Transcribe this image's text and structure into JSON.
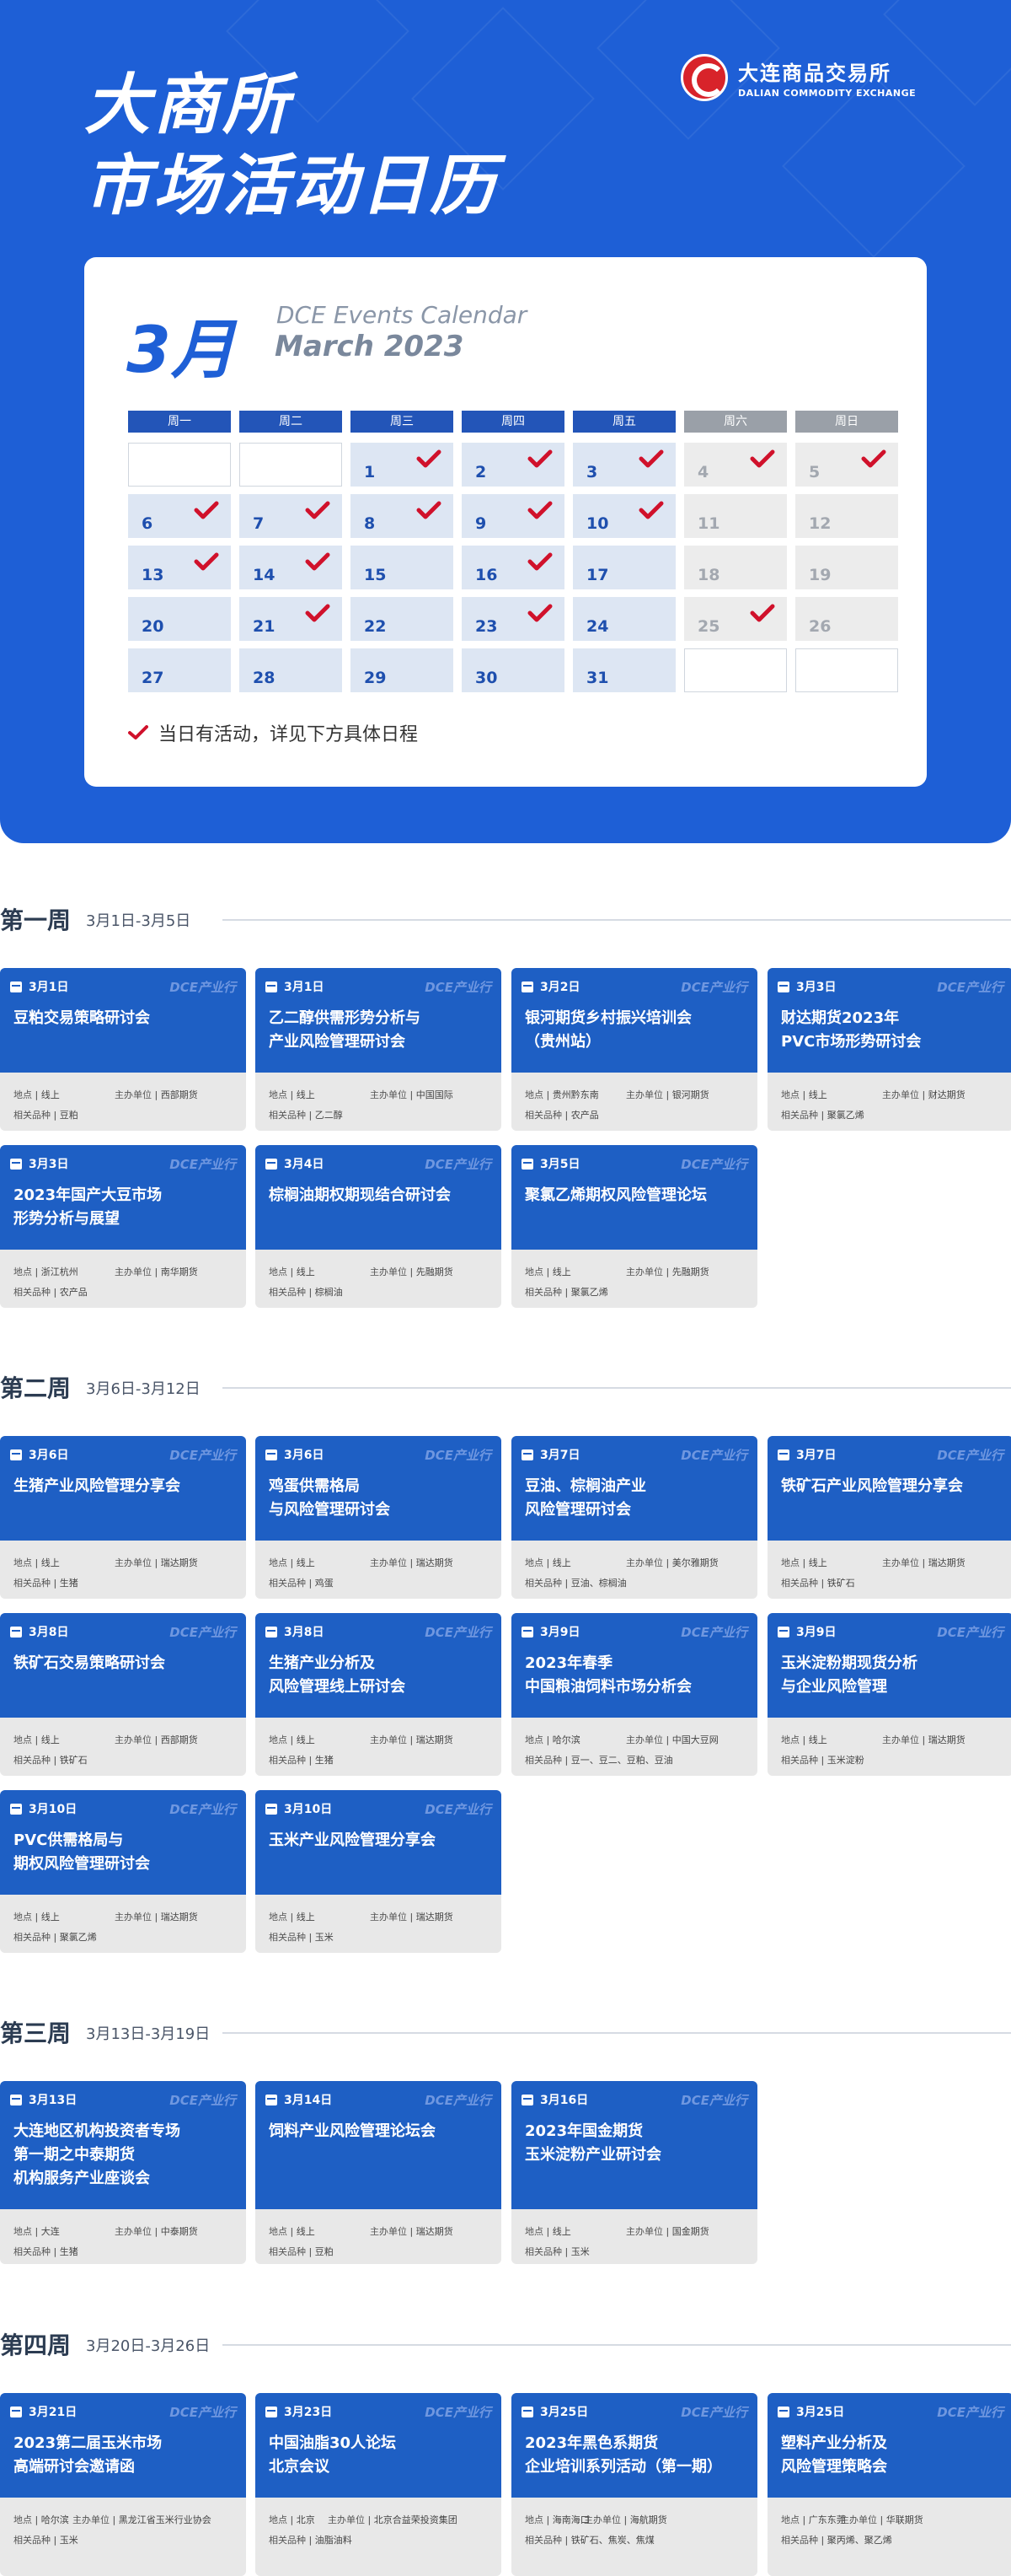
{
  "header": {
    "title_line1": "大商所",
    "title_line2": "市场活动日历",
    "logo_cn": "大连商品交易所",
    "logo_en": "DALIAN COMMODITY EXCHANGE"
  },
  "calendar": {
    "month": "3月",
    "subtitle_en": "DCE Events Calendar",
    "subtitle_month": "March 2023",
    "weekdays": [
      "周一",
      "周二",
      "周三",
      "周四",
      "周五",
      "周六",
      "周日"
    ],
    "weeks": [
      [
        {
          "d": ""
        },
        {
          "d": ""
        },
        {
          "d": "1",
          "ev": true
        },
        {
          "d": "2",
          "ev": true
        },
        {
          "d": "3",
          "ev": true
        },
        {
          "d": "4",
          "ev": true,
          "we": true
        },
        {
          "d": "5",
          "ev": true,
          "we": true
        }
      ],
      [
        {
          "d": "6",
          "ev": true
        },
        {
          "d": "7",
          "ev": true
        },
        {
          "d": "8",
          "ev": true
        },
        {
          "d": "9",
          "ev": true
        },
        {
          "d": "10",
          "ev": true
        },
        {
          "d": "11",
          "we": true
        },
        {
          "d": "12",
          "we": true
        }
      ],
      [
        {
          "d": "13",
          "ev": true
        },
        {
          "d": "14",
          "ev": true
        },
        {
          "d": "15"
        },
        {
          "d": "16",
          "ev": true
        },
        {
          "d": "17"
        },
        {
          "d": "18",
          "we": true
        },
        {
          "d": "19",
          "we": true
        }
      ],
      [
        {
          "d": "20"
        },
        {
          "d": "21",
          "ev": true
        },
        {
          "d": "22"
        },
        {
          "d": "23",
          "ev": true
        },
        {
          "d": "24"
        },
        {
          "d": "25",
          "ev": true,
          "we": true
        },
        {
          "d": "26",
          "we": true
        }
      ],
      [
        {
          "d": "27"
        },
        {
          "d": "28"
        },
        {
          "d": "29"
        },
        {
          "d": "30"
        },
        {
          "d": "31"
        },
        {
          "d": ""
        },
        {
          "d": ""
        }
      ]
    ],
    "legend": "当日有活动，详见下方具体日程"
  },
  "labels": {
    "brand": "DCE产业行",
    "location": "地点",
    "organizer": "主办单位",
    "product": "相关品种"
  },
  "weeks": [
    {
      "title": "第一周",
      "range": "3月1日-3月5日",
      "events": [
        {
          "date": "3月1日",
          "title": "豆粕交易策略研讨会",
          "loc": "线上",
          "org": "西部期货",
          "prod": "豆粕"
        },
        {
          "date": "3月1日",
          "title": "乙二醇供需形势分析与\n产业风险管理研讨会",
          "loc": "线上",
          "org": "中国国际",
          "prod": "乙二醇"
        },
        {
          "date": "3月2日",
          "title": "银河期货乡村振兴培训会\n（贵州站）",
          "loc": "贵州黔东南",
          "org": "银河期货",
          "prod": "农产品"
        },
        {
          "date": "3月3日",
          "title": "财达期货2023年\nPVC市场形势研讨会",
          "loc": "线上",
          "org": "财达期货",
          "prod": "聚氯乙烯"
        },
        {
          "date": "3月3日",
          "title": "2023年国产大豆市场\n形势分析与展望",
          "loc": "浙江杭州",
          "org": "南华期货",
          "prod": "农产品"
        },
        {
          "date": "3月4日",
          "title": "棕榈油期权期现结合研讨会",
          "loc": "线上",
          "org": "先融期货",
          "prod": "棕榈油"
        },
        {
          "date": "3月5日",
          "title": "聚氯乙烯期权风险管理论坛",
          "loc": "线上",
          "org": "先融期货",
          "prod": "聚氯乙烯"
        }
      ]
    },
    {
      "title": "第二周",
      "range": "3月6日-3月12日",
      "events": [
        {
          "date": "3月6日",
          "title": "生猪产业风险管理分享会",
          "loc": "线上",
          "org": "瑞达期货",
          "prod": "生猪"
        },
        {
          "date": "3月6日",
          "title": "鸡蛋供需格局\n与风险管理研讨会",
          "loc": "线上",
          "org": "瑞达期货",
          "prod": "鸡蛋"
        },
        {
          "date": "3月7日",
          "title": "豆油、棕榈油产业\n风险管理研讨会",
          "loc": "线上",
          "org": "美尔雅期货",
          "prod": "豆油、棕榈油"
        },
        {
          "date": "3月7日",
          "title": "铁矿石产业风险管理分享会",
          "loc": "线上",
          "org": "瑞达期货",
          "prod": "铁矿石"
        },
        {
          "date": "3月8日",
          "title": "铁矿石交易策略研讨会",
          "loc": "线上",
          "org": "西部期货",
          "prod": "铁矿石"
        },
        {
          "date": "3月8日",
          "title": "生猪产业分析及\n风险管理线上研讨会",
          "loc": "线上",
          "org": "瑞达期货",
          "prod": "生猪"
        },
        {
          "date": "3月9日",
          "title": "2023年春季\n中国粮油饲料市场分析会",
          "loc": "哈尔滨",
          "org": "中国大豆网",
          "prod": "豆一、豆二、豆粕、豆油"
        },
        {
          "date": "3月9日",
          "title": "玉米淀粉期现货分析\n与企业风险管理",
          "loc": "线上",
          "org": "瑞达期货",
          "prod": "玉米淀粉"
        },
        {
          "date": "3月10日",
          "title": "PVC供需格局与\n期权风险管理研讨会",
          "loc": "线上",
          "org": "瑞达期货",
          "prod": "聚氯乙烯"
        },
        {
          "date": "3月10日",
          "title": "玉米产业风险管理分享会",
          "loc": "线上",
          "org": "瑞达期货",
          "prod": "玉米"
        }
      ]
    },
    {
      "title": "第三周",
      "range": "3月13日-3月19日",
      "events": [
        {
          "date": "3月13日",
          "title": "大连地区机构投资者专场\n第一期之中泰期货\n机构服务产业座谈会",
          "loc": "大连",
          "org": "中泰期货",
          "prod": "生猪"
        },
        {
          "date": "3月14日",
          "title": "饲料产业风险管理论坛会",
          "loc": "线上",
          "org": "瑞达期货",
          "prod": "豆粕"
        },
        {
          "date": "3月16日",
          "title": "2023年国金期货\n玉米淀粉产业研讨会",
          "loc": "线上",
          "org": "国金期货",
          "prod": "玉米"
        }
      ]
    },
    {
      "title": "第四周",
      "range": "3月20日-3月26日",
      "events": [
        {
          "date": "3月21日",
          "title": "2023第二届玉米市场\n高端研讨会邀请函",
          "loc": "哈尔滨",
          "org": "黑龙江省玉米行业协会",
          "prod": "玉米"
        },
        {
          "date": "3月23日",
          "title": "中国油脂30人论坛\n北京会议",
          "loc": "北京",
          "org": "北京合益荣投资集团",
          "prod": "油脂油料"
        },
        {
          "date": "3月25日",
          "title": "2023年黑色系期货\n企业培训系列活动（第一期）",
          "loc": "海南海口",
          "org": "海航期货",
          "prod": "铁矿石、焦炭、焦煤"
        },
        {
          "date": "3月25日",
          "title": "塑料产业分析及\n风险管理策略会",
          "loc": "广东东莞",
          "org": "华联期货",
          "prod": "聚丙烯、聚乙烯"
        }
      ]
    }
  ],
  "colors": {
    "primary": "#1e5fd6",
    "event_bg": "#1e5fc4",
    "check": "#d0112b",
    "weekday_header": "#2355b8",
    "weekend_header": "#9aa0a8",
    "event_cell": "#dde6f3",
    "weekend_cell": "#ececec"
  }
}
